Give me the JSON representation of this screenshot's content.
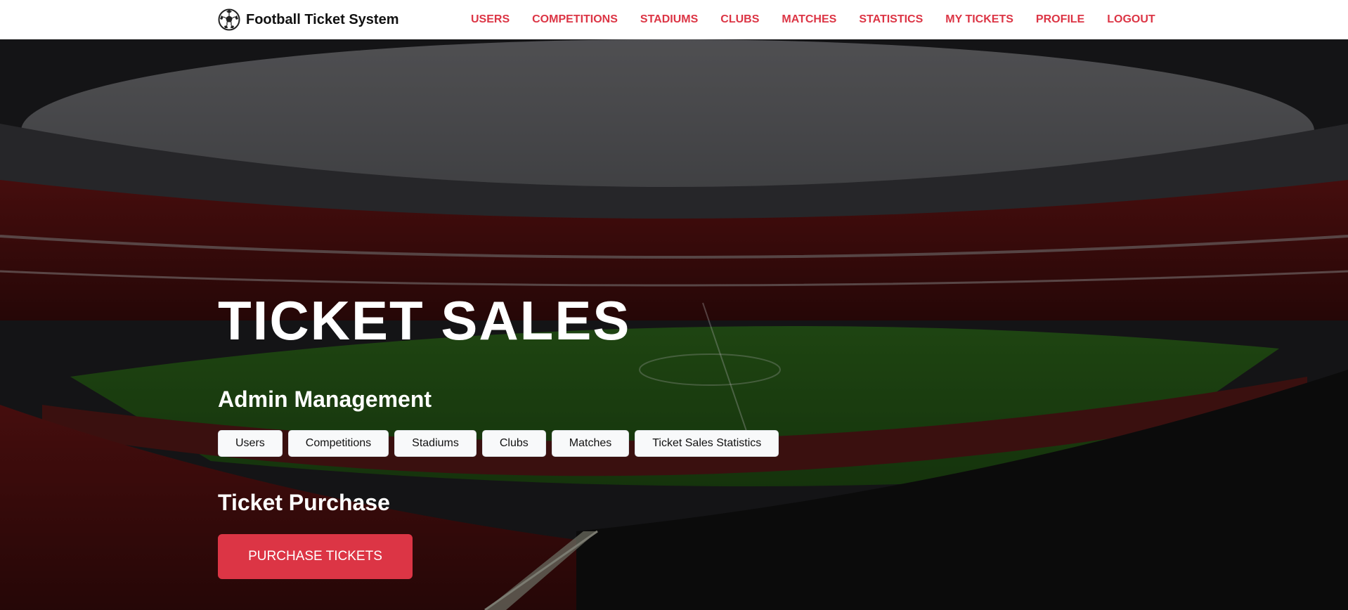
{
  "navbar": {
    "brand": "Football Ticket System",
    "brand_icon": "soccer-ball-icon",
    "links": [
      "USERS",
      "COMPETITIONS",
      "STADIUMS",
      "CLUBS",
      "MATCHES",
      "STATISTICS",
      "MY TICKETS",
      "PROFILE",
      "LOGOUT"
    ],
    "accent_color": "#dc3545"
  },
  "hero": {
    "title": "TICKET SALES",
    "admin": {
      "heading": "Admin Management",
      "buttons": [
        "Users",
        "Competitions",
        "Stadiums",
        "Clubs",
        "Matches",
        "Ticket Sales Statistics"
      ]
    },
    "purchase": {
      "heading": "Ticket Purchase",
      "button": "PURCHASE TICKETS"
    }
  }
}
